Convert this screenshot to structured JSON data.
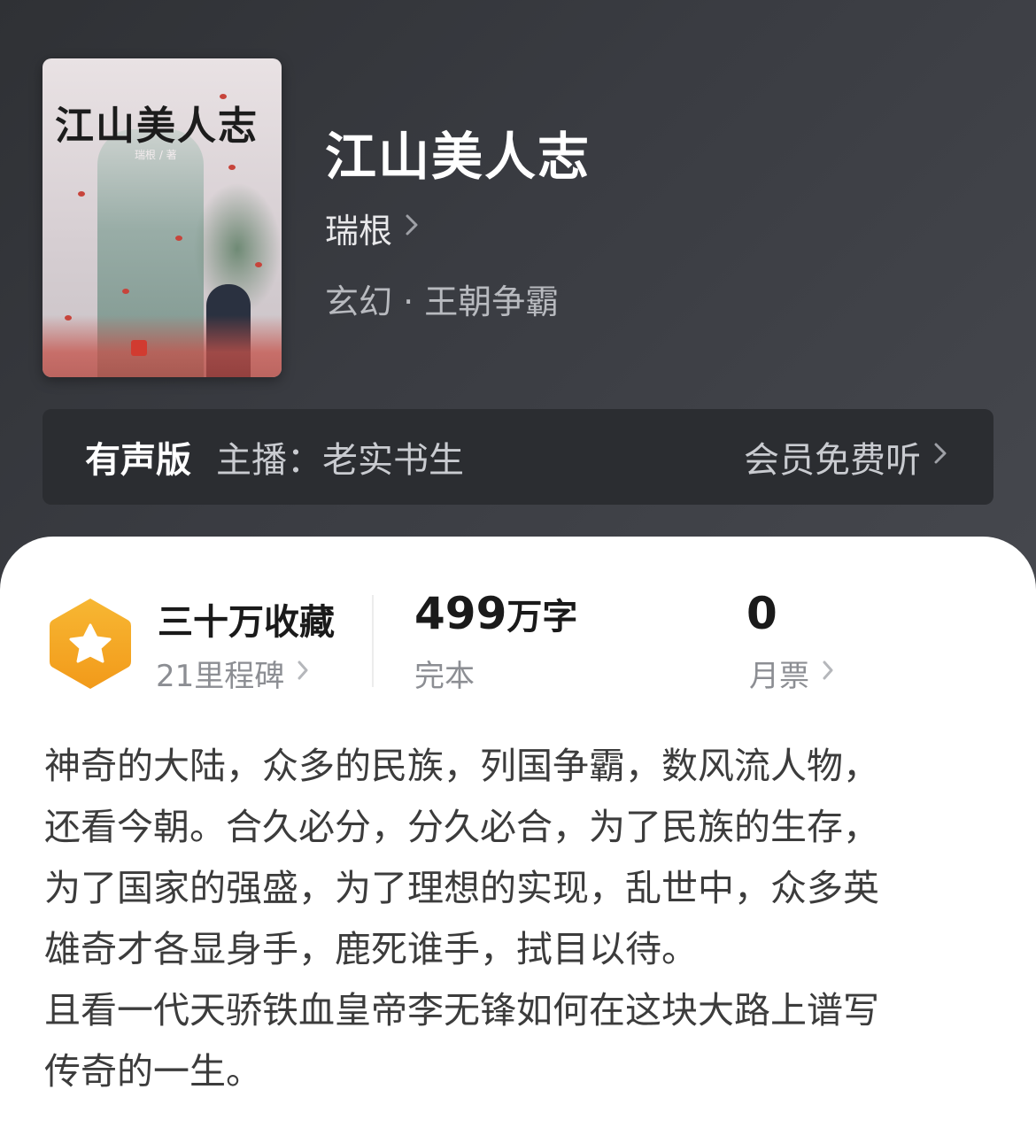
{
  "book": {
    "cover_title": "江山美人志",
    "cover_author": "瑞根 / 著",
    "title": "江山美人志",
    "author": "瑞根",
    "category": "玄幻 · 王朝争霸"
  },
  "audio": {
    "label": "有声版",
    "host": "主播：老实书生",
    "action": "会员免费听"
  },
  "stats": {
    "collection": "三十万收藏",
    "milestone": "21里程碑",
    "words_number": "499",
    "words_unit": "万字",
    "status": "完本",
    "monthly_votes": "0",
    "monthly_label": "月票"
  },
  "synopsis": {
    "para1_line1": "神奇的大陆，众多的民族，列国争霸，数风流人物，",
    "para1_line2": "还看今朝。合久必分，分久必合，为了民族的生存，",
    "para1_line3": "为了国家的强盛，为了理想的实现，乱世中，众多英",
    "para1_line4": "雄奇才各显身手，鹿死谁手，拭目以待。",
    "para2_line1": "且看一代天骄铁血皇帝李无锋如何在这块大路上谱写",
    "para2_line2": "传奇的一生。"
  },
  "colors": {
    "header_bg": "#3a3c41",
    "badge_orange": "#f5a623",
    "text_primary": "#1a1a1a",
    "text_secondary": "#8c8e93"
  },
  "icons": {
    "chevron": "chevron-right-icon",
    "badge": "star-badge-icon"
  }
}
